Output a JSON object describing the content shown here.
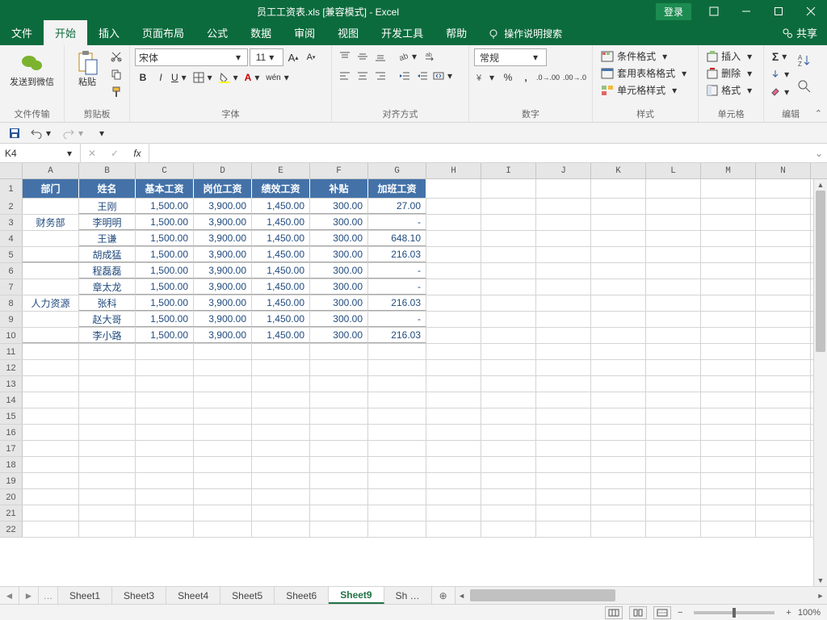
{
  "window": {
    "title": "员工工资表.xls  [兼容模式]  -  Excel",
    "login": "登录"
  },
  "tabs": {
    "file": "文件",
    "home": "开始",
    "insert": "插入",
    "layout": "页面布局",
    "formulas": "公式",
    "data": "数据",
    "review": "审阅",
    "view": "视图",
    "dev": "开发工具",
    "help": "帮助",
    "tellme": "操作说明搜索",
    "share": "共享"
  },
  "ribbon": {
    "wechat_send": "发送到微信",
    "wechat_group": "文件传输",
    "paste": "粘贴",
    "clipboard": "剪贴板",
    "font_name": "宋体",
    "font_size": "11",
    "font_group": "字体",
    "align_group": "对齐方式",
    "numfmt": "常规",
    "number_group": "数字",
    "cond_fmt": "条件格式",
    "table_fmt": "套用表格格式",
    "cell_style": "单元格样式",
    "styles_group": "样式",
    "insert": "插入",
    "delete": "删除",
    "format": "格式",
    "cells_group": "单元格",
    "editing_group": "编辑"
  },
  "formula": {
    "namebox": "K4",
    "fx": "fx",
    "value": ""
  },
  "columns": [
    "A",
    "B",
    "C",
    "D",
    "E",
    "F",
    "G",
    "H",
    "I",
    "J",
    "K",
    "L",
    "M",
    "N"
  ],
  "headers": {
    "dept": "部门",
    "name": "姓名",
    "base": "基本工资",
    "post": "岗位工资",
    "perf": "绩效工资",
    "allow": "补贴",
    "ot": "加班工资"
  },
  "data_rows": [
    {
      "dept": "财务部",
      "dept_span_first": true,
      "name": "王刚",
      "base": "1,500.00",
      "post": "3,900.00",
      "perf": "1,450.00",
      "allow": "300.00",
      "ot": "27.00"
    },
    {
      "name": "李明明",
      "base": "1,500.00",
      "post": "3,900.00",
      "perf": "1,450.00",
      "allow": "300.00",
      "ot": "-"
    },
    {
      "name": "王谦",
      "base": "1,500.00",
      "post": "3,900.00",
      "perf": "1,450.00",
      "allow": "300.00",
      "ot": "648.10"
    },
    {
      "dept_span_last_fin": true,
      "name": "胡成猛",
      "base": "1,500.00",
      "post": "3,900.00",
      "perf": "1,450.00",
      "allow": "300.00",
      "ot": "216.03"
    },
    {
      "dept": "人力资源",
      "dept_span_first": true,
      "name": "程磊磊",
      "base": "1,500.00",
      "post": "3,900.00",
      "perf": "1,450.00",
      "allow": "300.00",
      "ot": "-"
    },
    {
      "name": "章太龙",
      "base": "1,500.00",
      "post": "3,900.00",
      "perf": "1,450.00",
      "allow": "300.00",
      "ot": "-"
    },
    {
      "name": "张科",
      "base": "1,500.00",
      "post": "3,900.00",
      "perf": "1,450.00",
      "allow": "300.00",
      "ot": "216.03"
    },
    {
      "name": "赵大哥",
      "base": "1,500.00",
      "post": "3,900.00",
      "perf": "1,450.00",
      "allow": "300.00",
      "ot": "-"
    },
    {
      "dept_span_last_hr": true,
      "name": "李小路",
      "base": "1,500.00",
      "post": "3,900.00",
      "perf": "1,450.00",
      "allow": "300.00",
      "ot": "216.03"
    }
  ],
  "dept_labels": {
    "fin": "财务部",
    "hr": "人力资源"
  },
  "sheets": {
    "nav_more": "…",
    "s1": "Sheet1",
    "s3": "Sheet3",
    "s4": "Sheet4",
    "s5": "Sheet5",
    "s6": "Sheet6",
    "s9": "Sheet9",
    "overflow": "Sh  …"
  },
  "status": {
    "zoom": "100%"
  }
}
